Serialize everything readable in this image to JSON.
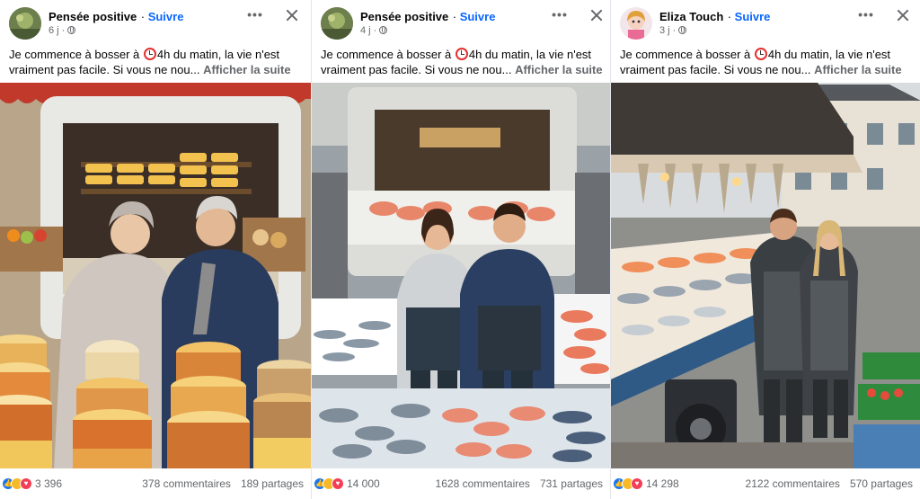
{
  "posts": [
    {
      "author": "Pensée positive",
      "follow": "Suivre",
      "time": "6 j ·",
      "text_before": "Je commence à bosser à",
      "text_after": "4h du matin, la vie n'est vraiment pas facile. Si vous ne nou...",
      "see_more": "Afficher la suite",
      "reactions": "3 396",
      "comments": "378 commentaires",
      "shares": "189 partages",
      "photo_desc": "cheese-stall"
    },
    {
      "author": "Pensée positive",
      "follow": "Suivre",
      "time": "4 j ·",
      "text_before": "Je commence à bosser à",
      "text_after": "4h du matin, la vie n'est vraiment pas facile. Si vous ne nou...",
      "see_more": "Afficher la suite",
      "reactions": "14 000",
      "comments": "1628 commentaires",
      "shares": "731 partages",
      "photo_desc": "fish-stall"
    },
    {
      "author": "Eliza Touch",
      "follow": "Suivre",
      "time": "3 j ·",
      "text_before": "Je commence à bosser à",
      "text_after": "4h du matin, la vie n'est vraiment pas facile. Si vous ne nou...",
      "see_more": "Afficher la suite",
      "reactions": "14 298",
      "comments": "2122 commentaires",
      "shares": "570 partages",
      "photo_desc": "fish-market-street"
    }
  ],
  "icons": {
    "more": "more-options-icon",
    "close": "close-icon",
    "reactions": [
      "like-icon",
      "haha-icon",
      "love-icon"
    ],
    "alarm": "alarm-clock-emoji"
  },
  "colors": {
    "link_blue": "#0866ff",
    "secondary_text": "#65676b",
    "like_blue": "#1877f2"
  }
}
